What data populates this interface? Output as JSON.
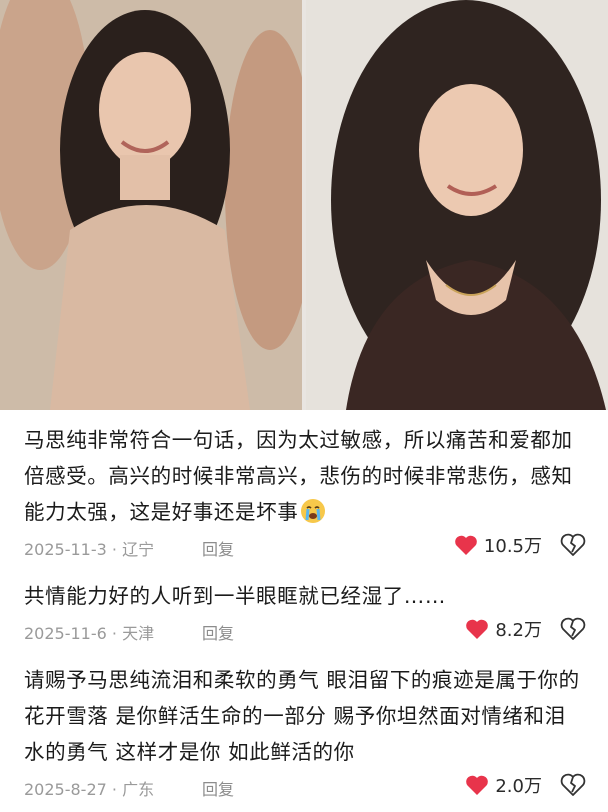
{
  "colors": {
    "heart": "#e8344b",
    "meta": "#9a9a9a",
    "text": "#1b1b1b"
  },
  "photos": [
    {
      "name": "photo-young",
      "icon": "portrait-photo"
    },
    {
      "name": "photo-recent",
      "icon": "portrait-photo"
    }
  ],
  "comments": [
    {
      "text": "马思纯非常符合一句话，因为太过敏感，所以痛苦和爱都加倍感受。高兴的时候非常高兴，悲伤的时候非常悲伤，感知能力太强，这是好事还是坏事",
      "date_location": "2025-11-3 · 辽宁",
      "reply_label": "回复",
      "likes": "10.5万",
      "trailing_emoji": "crying-face-emoji"
    },
    {
      "text": "共情能力好的人听到一半眼眶就已经湿了……",
      "date_location": "2025-11-6 · 天津",
      "reply_label": "回复",
      "likes": "8.2万"
    },
    {
      "text": "请赐予马思纯流泪和柔软的勇气 眼泪留下的痕迹是属于你的花开雪落 是你鲜活生命的一部分 赐予你坦然面对情绪和泪水的勇气 这样才是你 如此鲜活的你",
      "date_location": "2025-8-27 · 广东",
      "reply_label": "回复",
      "likes": "2.0万"
    }
  ]
}
